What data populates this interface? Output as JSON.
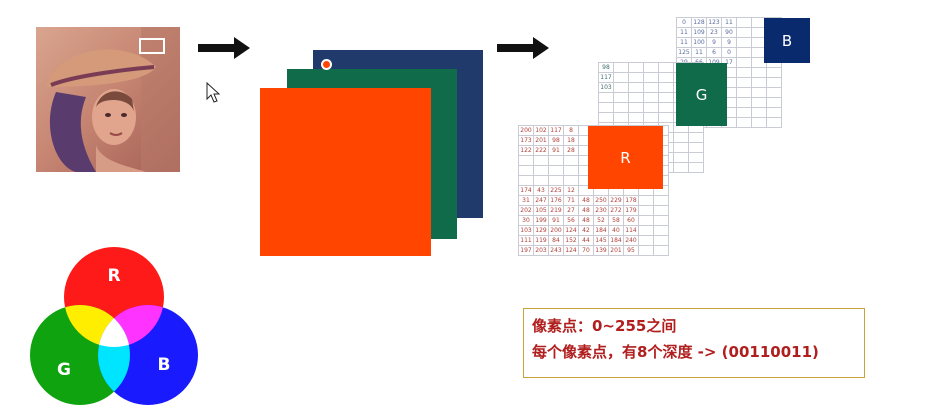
{
  "labels": {
    "r": "R",
    "g": "G",
    "b": "B"
  },
  "info": {
    "line1": "像素点：0~255之间",
    "line2": "每个像素点，有8个深度 -> (00110011)"
  },
  "matrix_b": [
    [
      "0",
      "128",
      "123",
      "11",
      "",
      "",
      ""
    ],
    [
      "11",
      "109",
      "23",
      "90",
      "",
      "",
      ""
    ],
    [
      "11",
      "100",
      "9",
      "9",
      "",
      "",
      ""
    ],
    [
      "125",
      "11",
      "6",
      "0",
      "",
      "",
      ""
    ],
    [
      "29",
      "66",
      "109",
      "17",
      "",
      "",
      ""
    ],
    [
      "",
      "",
      "",
      "",
      "",
      "",
      ""
    ],
    [
      "",
      "",
      "",
      "",
      "",
      "",
      ""
    ],
    [
      "",
      "",
      "",
      "",
      "",
      "",
      ""
    ],
    [
      "",
      "",
      "",
      "",
      "",
      "",
      ""
    ],
    [
      "",
      "",
      "",
      "",
      "",
      "",
      ""
    ],
    [
      "",
      "",
      "",
      "",
      "",
      "",
      ""
    ]
  ],
  "matrix_g": [
    [
      "98",
      "",
      "",
      "",
      "",
      "",
      ""
    ],
    [
      "117",
      "",
      "",
      "",
      "",
      "",
      ""
    ],
    [
      "103",
      "",
      "",
      "",
      "",
      "",
      ""
    ],
    [
      "",
      "",
      "",
      "",
      "",
      "",
      ""
    ],
    [
      "",
      "",
      "",
      "",
      "",
      "",
      ""
    ],
    [
      "",
      "",
      "",
      "",
      "",
      "",
      ""
    ],
    [
      "",
      "",
      "",
      "",
      "",
      "",
      ""
    ],
    [
      "",
      "",
      "",
      "",
      "",
      "",
      ""
    ],
    [
      "",
      "",
      "",
      "",
      "",
      "",
      ""
    ],
    [
      "",
      "",
      "",
      "",
      "",
      "",
      ""
    ],
    [
      "",
      "",
      "",
      "",
      "",
      "",
      ""
    ]
  ],
  "matrix_r": [
    [
      "200",
      "102",
      "117",
      "8",
      "",
      "",
      "",
      "",
      "",
      ""
    ],
    [
      "173",
      "201",
      "98",
      "18",
      "",
      "",
      "",
      "",
      "",
      ""
    ],
    [
      "122",
      "222",
      "91",
      "28",
      "",
      "",
      "",
      "",
      "",
      ""
    ],
    [
      "",
      "",
      "",
      "",
      "",
      "",
      "",
      "",
      "",
      ""
    ],
    [
      "",
      "",
      "",
      "",
      "",
      "",
      "",
      "",
      "",
      ""
    ],
    [
      "",
      "",
      "",
      "",
      "",
      "",
      "",
      "",
      "",
      ""
    ],
    [
      "174",
      "43",
      "225",
      "12",
      "",
      "",
      "",
      "",
      "",
      ""
    ],
    [
      "31",
      "247",
      "176",
      "71",
      "48",
      "250",
      "229",
      "178",
      "",
      ""
    ],
    [
      "202",
      "105",
      "219",
      "27",
      "48",
      "230",
      "272",
      "179",
      "",
      ""
    ],
    [
      "30",
      "199",
      "91",
      "56",
      "48",
      "52",
      "58",
      "60",
      "",
      ""
    ],
    [
      "103",
      "129",
      "200",
      "124",
      "42",
      "184",
      "40",
      "114",
      "",
      ""
    ],
    [
      "111",
      "119",
      "84",
      "152",
      "44",
      "145",
      "184",
      "240",
      "",
      ""
    ],
    [
      "197",
      "203",
      "243",
      "124",
      "70",
      "139",
      "201",
      "95",
      "",
      ""
    ]
  ],
  "icons": {
    "arrow": "right-arrow-icon",
    "cursor": "mouse-pointer-icon"
  },
  "colors": {
    "red": "#ff4500",
    "green": "#0f6b49",
    "blue": "#1f3a6b",
    "info_text": "#b01e1e",
    "info_border": "#c9a23b"
  }
}
